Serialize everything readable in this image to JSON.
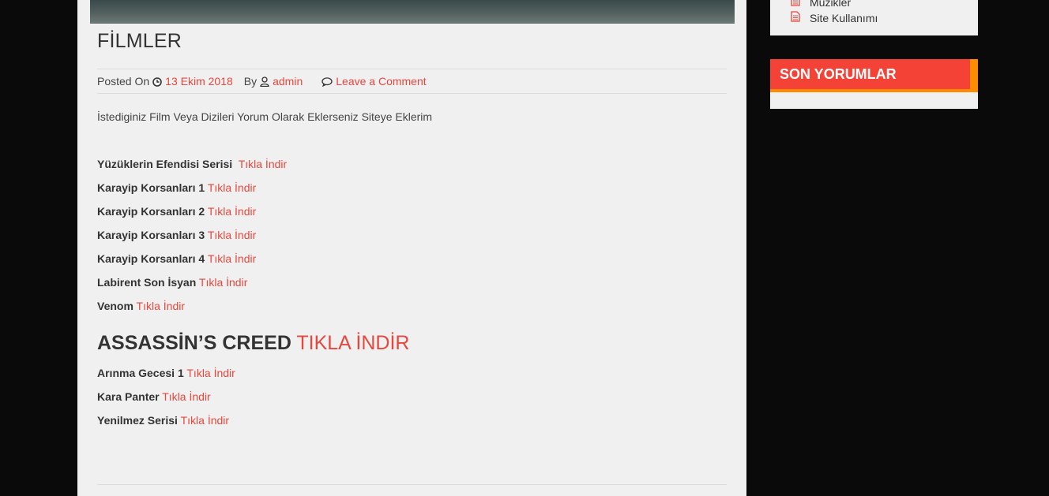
{
  "post": {
    "title": "FİLMLER",
    "meta": {
      "posted_on_label": "Posted On",
      "date": "13 Ekim 2018",
      "by_label": "By",
      "author": "admin",
      "comment_link": "Leave a Comment"
    },
    "intro": "İstediginiz Film Veya Dizileri Yorum Olarak Eklerseniz Siteye Eklerim",
    "items": [
      {
        "title": "Yüzüklerin Efendisi Serisi",
        "link": "Tıkla İndir"
      },
      {
        "title": "Karayip Korsanları 1",
        "link": "Tıkla İndir"
      },
      {
        "title": "Karayip Korsanları 2",
        "link": "Tıkla İndir"
      },
      {
        "title": "Karayip Korsanları 3",
        "link": "Tıkla İndir"
      },
      {
        "title": "Karayip Korsanları 4",
        "link": "Tıkla İndir"
      },
      {
        "title": "Labirent Son İsyan",
        "link": "Tıkla İndir"
      },
      {
        "title": "Venom",
        "link": "Tıkla İndir"
      }
    ],
    "featured": {
      "title": "ASSASSİN’S CREED",
      "link": "TIKLA İNDİR"
    },
    "items2": [
      {
        "title": "Arınma Gecesi 1",
        "link": "Tıkla İndir"
      },
      {
        "title": "Kara Panter",
        "link": "Tıkla İndir"
      },
      {
        "title": "Yenilmez Serisi",
        "link": "Tıkla İndir"
      }
    ]
  },
  "sidebar": {
    "pages": [
      {
        "label": "Müzikler",
        "icon": "document-icon"
      },
      {
        "label": "Site Kullanımı",
        "icon": "document-icon"
      }
    ],
    "recent_comments": {
      "title": "SON YORUMLAR"
    }
  },
  "colors": {
    "accent": "#e8473d",
    "widget_header": "#f44336",
    "widget_header_border": "#ff8c00",
    "panel": "#f0f0f0",
    "background": "#0a0a0a"
  }
}
